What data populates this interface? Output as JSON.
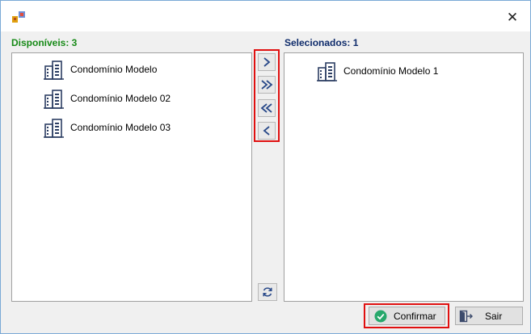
{
  "window": {
    "title": "",
    "close_glyph": "✕"
  },
  "left_panel": {
    "header": "Disponíveis: 3",
    "items": [
      {
        "label": "Condomínio Modelo",
        "icon": "building-icon"
      },
      {
        "label": "Condomínio Modelo 02",
        "icon": "building-icon"
      },
      {
        "label": "Condomínio Modelo 03",
        "icon": "building-icon"
      }
    ]
  },
  "right_panel": {
    "header": "Selecionados: 1",
    "items": [
      {
        "label": "Condomínio Modelo 1",
        "icon": "building-icon"
      }
    ]
  },
  "transfer_buttons": {
    "move_one_right": "move-right-icon",
    "move_all_right": "move-all-right-icon",
    "move_all_left": "move-all-left-icon",
    "move_one_left": "move-left-icon",
    "refresh": "refresh-icon"
  },
  "footer": {
    "confirm_label": "Confirmar",
    "exit_label": "Sair"
  },
  "colors": {
    "available_header": "#178a17",
    "selected_header": "#0e2b6b",
    "highlight": "#e01010",
    "icon_blue": "#2c3e63",
    "confirm_green": "#27a86b"
  }
}
